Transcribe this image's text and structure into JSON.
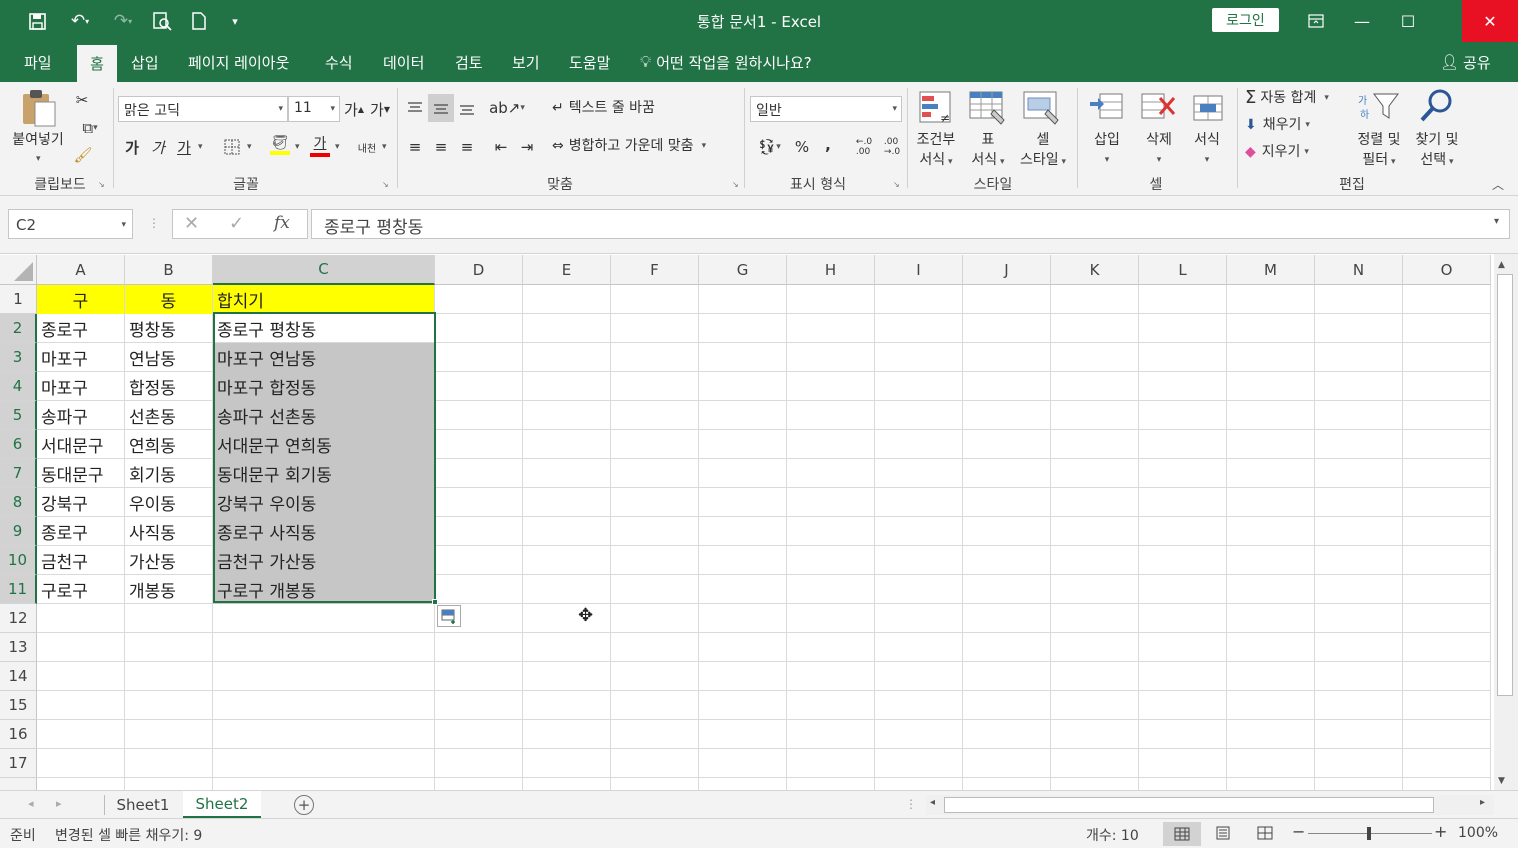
{
  "titlebar": {
    "title": "통합 문서1  -  Excel",
    "login_label": "로그인"
  },
  "tabs": [
    "파일",
    "홈",
    "삽입",
    "페이지 레이아웃",
    "수식",
    "데이터",
    "검토",
    "보기",
    "도움말"
  ],
  "tell_me": "어떤 작업을 원하시나요?",
  "share_label": "공유",
  "ribbon": {
    "clipboard": {
      "paste": "붙여넣기",
      "label": "클립보드"
    },
    "font": {
      "name": "맑은 고딕",
      "size": "11",
      "label": "글꼴",
      "grow": "가",
      "shrink": "가",
      "bold": "가",
      "italic": "가",
      "underline": "가",
      "color_a": "가",
      "phonetic": "내천"
    },
    "align": {
      "wrap": "텍스트 줄 바꿈",
      "merge": "병합하고 가운데 맞춤",
      "label": "맞춤"
    },
    "number": {
      "format": "일반",
      "percent": "%",
      "comma": ",",
      "label": "표시 형식"
    },
    "styles": {
      "cond1": "조건부",
      "cond2": "서식",
      "table1": "표",
      "table2": "서식",
      "cell1": "셀",
      "cell2": "스타일",
      "label": "스타일"
    },
    "cells": {
      "insert": "삽입",
      "delete": "삭제",
      "format": "서식",
      "label": "셀"
    },
    "editing": {
      "autosum": "자동 합계",
      "fill": "채우기",
      "clear": "지우기",
      "sort1": "정렬 및",
      "sort2": "필터",
      "find1": "찾기 및",
      "find2": "선택",
      "label": "편집"
    }
  },
  "formula_bar": {
    "name_box": "C2",
    "fx": "fx",
    "content": "종로구 평창동"
  },
  "columns": [
    "A",
    "B",
    "C",
    "D",
    "E",
    "F",
    "G",
    "H",
    "I",
    "J",
    "K",
    "L",
    "M",
    "N",
    "O"
  ],
  "rows": [
    "1",
    "2",
    "3",
    "4",
    "5",
    "6",
    "7",
    "8",
    "9",
    "10",
    "11",
    "12",
    "13",
    "14",
    "15",
    "16",
    "17"
  ],
  "cells": {
    "header": [
      "구",
      "동",
      "합치기"
    ],
    "data": [
      [
        "종로구",
        "평창동",
        "종로구 평창동"
      ],
      [
        "마포구",
        "연남동",
        "마포구 연남동"
      ],
      [
        "마포구",
        "합정동",
        "마포구 합정동"
      ],
      [
        "송파구",
        "선촌동",
        "송파구 선촌동"
      ],
      [
        "서대문구",
        "연희동",
        "서대문구 연희동"
      ],
      [
        "동대문구",
        "회기동",
        "동대문구 회기동"
      ],
      [
        "강북구",
        "우이동",
        "강북구 우이동"
      ],
      [
        "종로구",
        "사직동",
        "종로구 사직동"
      ],
      [
        "금천구",
        "가산동",
        "금천구 가산동"
      ],
      [
        "구로구",
        "개봉동",
        "구로구 개봉동"
      ]
    ]
  },
  "sheets": [
    "Sheet1",
    "Sheet2"
  ],
  "active_sheet": "Sheet2",
  "status": {
    "ready": "준비",
    "message": "변경된 셀 빠른 채우기: 9",
    "count": "개수: 10",
    "zoom": "100%"
  },
  "colors": {
    "accent": "#217346",
    "highlight": "#ffff00",
    "flashfill": "#c6c6c6"
  }
}
